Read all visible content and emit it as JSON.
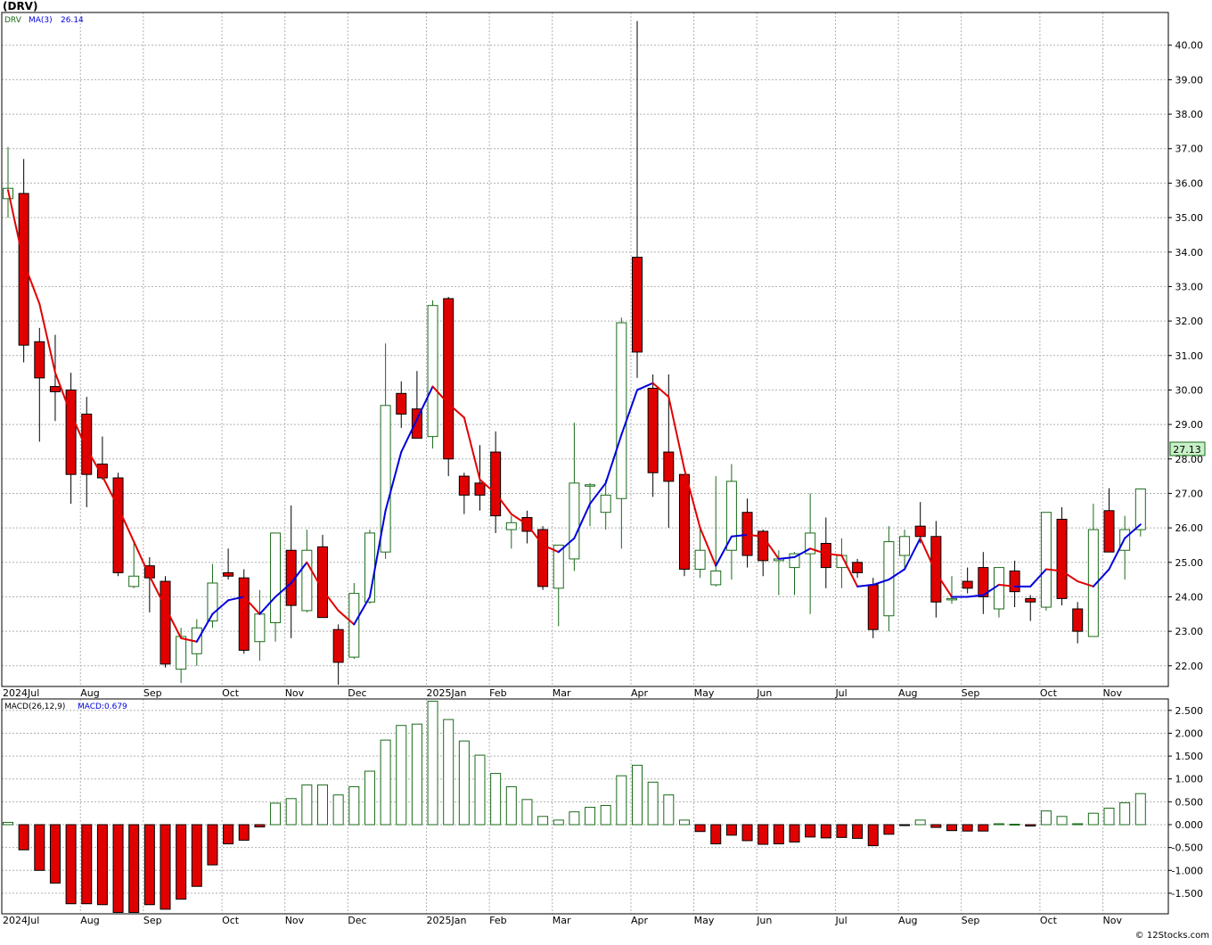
{
  "header": {
    "title": "(DRV)",
    "ticker": "DRV",
    "ma_label": "MA(3)",
    "ma_value": "26.14",
    "macd_label": "MACD(26,12,9)",
    "macd_value_label": "MACD:0.679",
    "last_price_label": "27.13",
    "watermark": "© 12Stocks.com"
  },
  "colors": {
    "up_candle": "#1a6b1a",
    "down_candle": "#e00000",
    "ma_up": "#0000dd",
    "ma_down": "#e00000",
    "grid": "#b0b0b0",
    "price_box": "#c8f0c8"
  },
  "chart_data": [
    {
      "type": "candlestick",
      "title": "(DRV)",
      "period": "weekly",
      "ylim": [
        21.4,
        40.95
      ],
      "yticks": [
        "22.00",
        "23.00",
        "24.00",
        "25.00",
        "26.00",
        "27.00",
        "28.00",
        "29.00",
        "30.00",
        "31.00",
        "32.00",
        "33.00",
        "34.00",
        "35.00",
        "36.00",
        "37.00",
        "38.00",
        "39.00",
        "40.00"
      ],
      "xticks": [
        {
          "label": "2024Jul",
          "week": 0
        },
        {
          "label": "Aug",
          "week": 5
        },
        {
          "label": "Sep",
          "week": 9
        },
        {
          "label": "Oct",
          "week": 14
        },
        {
          "label": "Nov",
          "week": 18
        },
        {
          "label": "Dec",
          "week": 22
        },
        {
          "label": "2025Jan",
          "week": 27
        },
        {
          "label": "Feb",
          "week": 31
        },
        {
          "label": "Mar",
          "week": 35
        },
        {
          "label": "Apr",
          "week": 40
        },
        {
          "label": "May",
          "week": 44
        },
        {
          "label": "Jun",
          "week": 48
        },
        {
          "label": "Jul",
          "week": 53
        },
        {
          "label": "Aug",
          "week": 57
        },
        {
          "label": "Sep",
          "week": 61
        },
        {
          "label": "Oct",
          "week": 66
        },
        {
          "label": "Nov",
          "week": 70
        }
      ],
      "candles": [
        {
          "o": 35.55,
          "h": 37.05,
          "l": 35.0,
          "c": 35.85
        },
        {
          "o": 35.7,
          "h": 36.7,
          "l": 30.8,
          "c": 31.3
        },
        {
          "o": 31.4,
          "h": 31.8,
          "l": 28.5,
          "c": 30.35
        },
        {
          "o": 30.1,
          "h": 31.6,
          "l": 29.1,
          "c": 29.95
        },
        {
          "o": 30.0,
          "h": 30.5,
          "l": 26.7,
          "c": 27.55
        },
        {
          "o": 29.3,
          "h": 29.8,
          "l": 26.6,
          "c": 27.55
        },
        {
          "o": 27.85,
          "h": 28.65,
          "l": 27.4,
          "c": 27.45
        },
        {
          "o": 27.45,
          "h": 27.6,
          "l": 24.6,
          "c": 24.7
        },
        {
          "o": 24.3,
          "h": 25.6,
          "l": 24.25,
          "c": 24.6
        },
        {
          "o": 24.9,
          "h": 25.15,
          "l": 23.55,
          "c": 24.55
        },
        {
          "o": 24.45,
          "h": 24.6,
          "l": 21.95,
          "c": 22.05
        },
        {
          "o": 21.9,
          "h": 23.1,
          "l": 21.5,
          "c": 22.85
        },
        {
          "o": 22.35,
          "h": 23.35,
          "l": 22.0,
          "c": 23.1
        },
        {
          "o": 23.3,
          "h": 24.95,
          "l": 23.1,
          "c": 24.4
        },
        {
          "o": 24.7,
          "h": 25.4,
          "l": 24.5,
          "c": 24.6
        },
        {
          "o": 24.55,
          "h": 24.8,
          "l": 22.35,
          "c": 22.45
        },
        {
          "o": 22.7,
          "h": 24.2,
          "l": 22.15,
          "c": 23.5
        },
        {
          "o": 23.25,
          "h": 25.85,
          "l": 22.7,
          "c": 25.85
        },
        {
          "o": 25.35,
          "h": 26.65,
          "l": 22.8,
          "c": 23.75
        },
        {
          "o": 23.6,
          "h": 25.95,
          "l": 23.55,
          "c": 25.35
        },
        {
          "o": 25.45,
          "h": 25.8,
          "l": 23.4,
          "c": 23.4
        },
        {
          "o": 23.05,
          "h": 23.2,
          "l": 21.45,
          "c": 22.1
        },
        {
          "o": 22.25,
          "h": 24.4,
          "l": 22.2,
          "c": 24.1
        },
        {
          "o": 23.85,
          "h": 25.95,
          "l": 23.8,
          "c": 25.85
        },
        {
          "o": 25.3,
          "h": 31.35,
          "l": 25.1,
          "c": 29.55
        },
        {
          "o": 29.9,
          "h": 30.25,
          "l": 28.9,
          "c": 29.3
        },
        {
          "o": 29.45,
          "h": 30.55,
          "l": 28.6,
          "c": 28.6
        },
        {
          "o": 28.65,
          "h": 32.6,
          "l": 28.3,
          "c": 32.45
        },
        {
          "o": 32.65,
          "h": 32.7,
          "l": 27.5,
          "c": 28.0
        },
        {
          "o": 27.5,
          "h": 27.6,
          "l": 26.4,
          "c": 26.95
        },
        {
          "o": 27.3,
          "h": 28.4,
          "l": 26.5,
          "c": 26.95
        },
        {
          "o": 28.2,
          "h": 28.8,
          "l": 25.85,
          "c": 26.35
        },
        {
          "o": 25.95,
          "h": 26.35,
          "l": 25.4,
          "c": 26.15
        },
        {
          "o": 26.3,
          "h": 26.5,
          "l": 25.55,
          "c": 25.9
        },
        {
          "o": 25.95,
          "h": 26.05,
          "l": 24.2,
          "c": 24.3
        },
        {
          "o": 24.25,
          "h": 25.5,
          "l": 23.15,
          "c": 25.5
        },
        {
          "o": 25.1,
          "h": 29.05,
          "l": 24.75,
          "c": 27.3
        },
        {
          "o": 27.25,
          "h": 27.3,
          "l": 26.05,
          "c": 27.25
        },
        {
          "o": 26.45,
          "h": 27.4,
          "l": 25.95,
          "c": 26.95
        },
        {
          "o": 26.85,
          "h": 32.1,
          "l": 25.4,
          "c": 31.95
        },
        {
          "o": 33.85,
          "h": 40.7,
          "l": 30.35,
          "c": 31.1
        },
        {
          "o": 30.05,
          "h": 30.45,
          "l": 26.9,
          "c": 27.6
        },
        {
          "o": 28.2,
          "h": 30.45,
          "l": 26.0,
          "c": 27.35
        },
        {
          "o": 27.55,
          "h": 27.55,
          "l": 24.6,
          "c": 24.8
        },
        {
          "o": 24.8,
          "h": 26.05,
          "l": 24.55,
          "c": 25.35
        },
        {
          "o": 24.35,
          "h": 27.5,
          "l": 24.3,
          "c": 24.75
        },
        {
          "o": 25.35,
          "h": 27.85,
          "l": 24.5,
          "c": 27.35
        },
        {
          "o": 26.45,
          "h": 26.85,
          "l": 24.85,
          "c": 25.2
        },
        {
          "o": 25.9,
          "h": 25.95,
          "l": 24.6,
          "c": 25.05
        },
        {
          "o": 25.05,
          "h": 25.35,
          "l": 24.05,
          "c": 25.1
        },
        {
          "o": 24.85,
          "h": 25.3,
          "l": 24.05,
          "c": 25.25
        },
        {
          "o": 25.25,
          "h": 27.0,
          "l": 23.5,
          "c": 25.85
        },
        {
          "o": 25.55,
          "h": 26.3,
          "l": 24.25,
          "c": 24.85
        },
        {
          "o": 24.85,
          "h": 25.7,
          "l": 24.25,
          "c": 25.2
        },
        {
          "o": 25.0,
          "h": 25.1,
          "l": 24.55,
          "c": 24.7
        },
        {
          "o": 24.35,
          "h": 24.55,
          "l": 22.8,
          "c": 23.05
        },
        {
          "o": 23.45,
          "h": 26.05,
          "l": 23.0,
          "c": 25.6
        },
        {
          "o": 25.2,
          "h": 25.95,
          "l": 24.85,
          "c": 25.75
        },
        {
          "o": 26.05,
          "h": 26.75,
          "l": 25.55,
          "c": 25.75
        },
        {
          "o": 25.75,
          "h": 26.2,
          "l": 23.4,
          "c": 23.85
        },
        {
          "o": 23.95,
          "h": 24.6,
          "l": 23.8,
          "c": 23.95
        },
        {
          "o": 24.45,
          "h": 24.85,
          "l": 24.1,
          "c": 24.25
        },
        {
          "o": 24.85,
          "h": 25.3,
          "l": 23.5,
          "c": 24.0
        },
        {
          "o": 23.65,
          "h": 24.85,
          "l": 23.4,
          "c": 24.85
        },
        {
          "o": 24.75,
          "h": 25.05,
          "l": 23.7,
          "c": 24.15
        },
        {
          "o": 23.95,
          "h": 24.05,
          "l": 23.3,
          "c": 23.85
        },
        {
          "o": 23.7,
          "h": 26.45,
          "l": 23.6,
          "c": 26.45
        },
        {
          "o": 26.25,
          "h": 26.6,
          "l": 23.75,
          "c": 23.95
        },
        {
          "o": 23.65,
          "h": 23.85,
          "l": 22.65,
          "c": 23.0
        },
        {
          "o": 22.85,
          "h": 26.7,
          "l": 22.85,
          "c": 25.95
        },
        {
          "o": 26.5,
          "h": 27.15,
          "l": 25.3,
          "c": 25.3
        },
        {
          "o": 25.35,
          "h": 26.35,
          "l": 24.5,
          "c": 25.95
        },
        {
          "o": 25.95,
          "h": 27.13,
          "l": 25.75,
          "c": 27.13
        }
      ],
      "ma3": [
        35.8,
        33.7,
        32.5,
        30.5,
        29.3,
        28.3,
        27.5,
        26.6,
        25.6,
        24.6,
        23.7,
        22.8,
        22.7,
        23.5,
        23.9,
        24.0,
        23.5,
        24.0,
        24.4,
        25.0,
        24.2,
        23.6,
        23.2,
        24.0,
        26.5,
        28.2,
        29.15,
        30.1,
        29.6,
        29.2,
        27.4,
        27.0,
        26.4,
        26.1,
        25.5,
        25.3,
        25.7,
        26.7,
        27.3,
        28.7,
        30.0,
        30.2,
        29.8,
        27.7,
        26.0,
        24.9,
        25.75,
        25.8,
        25.75,
        25.1,
        25.15,
        25.4,
        25.25,
        25.2,
        24.3,
        24.35,
        24.5,
        24.8,
        25.7,
        24.7,
        24.0,
        24.0,
        24.05,
        24.35,
        24.3,
        24.3,
        24.8,
        24.75,
        24.45,
        24.3,
        24.8,
        25.7,
        26.1
      ]
    },
    {
      "type": "bar",
      "title": "MACD(26,12,9)",
      "ylim": [
        -1.95,
        2.75
      ],
      "yticks": [
        "-1.500",
        "-1.000",
        "-0.500",
        "0.000",
        "0.500",
        "1.000",
        "1.500",
        "2.000",
        "2.500"
      ],
      "values": [
        0.05,
        -0.55,
        -1.0,
        -1.28,
        -1.73,
        -1.73,
        -1.75,
        -1.92,
        -1.92,
        -1.75,
        -1.85,
        -1.63,
        -1.35,
        -0.88,
        -0.42,
        -0.34,
        -0.05,
        0.47,
        0.57,
        0.87,
        0.87,
        0.65,
        0.83,
        1.17,
        1.85,
        2.17,
        2.2,
        2.7,
        2.3,
        1.83,
        1.52,
        1.12,
        0.83,
        0.55,
        0.18,
        0.1,
        0.28,
        0.38,
        0.42,
        1.07,
        1.3,
        0.93,
        0.65,
        0.1,
        -0.15,
        -0.42,
        -0.23,
        -0.35,
        -0.43,
        -0.42,
        -0.38,
        -0.27,
        -0.29,
        -0.28,
        -0.3,
        -0.46,
        -0.21,
        -0.02,
        0.1,
        -0.06,
        -0.13,
        -0.14,
        -0.14,
        0.02,
        0.01,
        -0.03,
        0.3,
        0.18,
        0.02,
        0.25,
        0.36,
        0.48,
        0.679
      ]
    }
  ]
}
